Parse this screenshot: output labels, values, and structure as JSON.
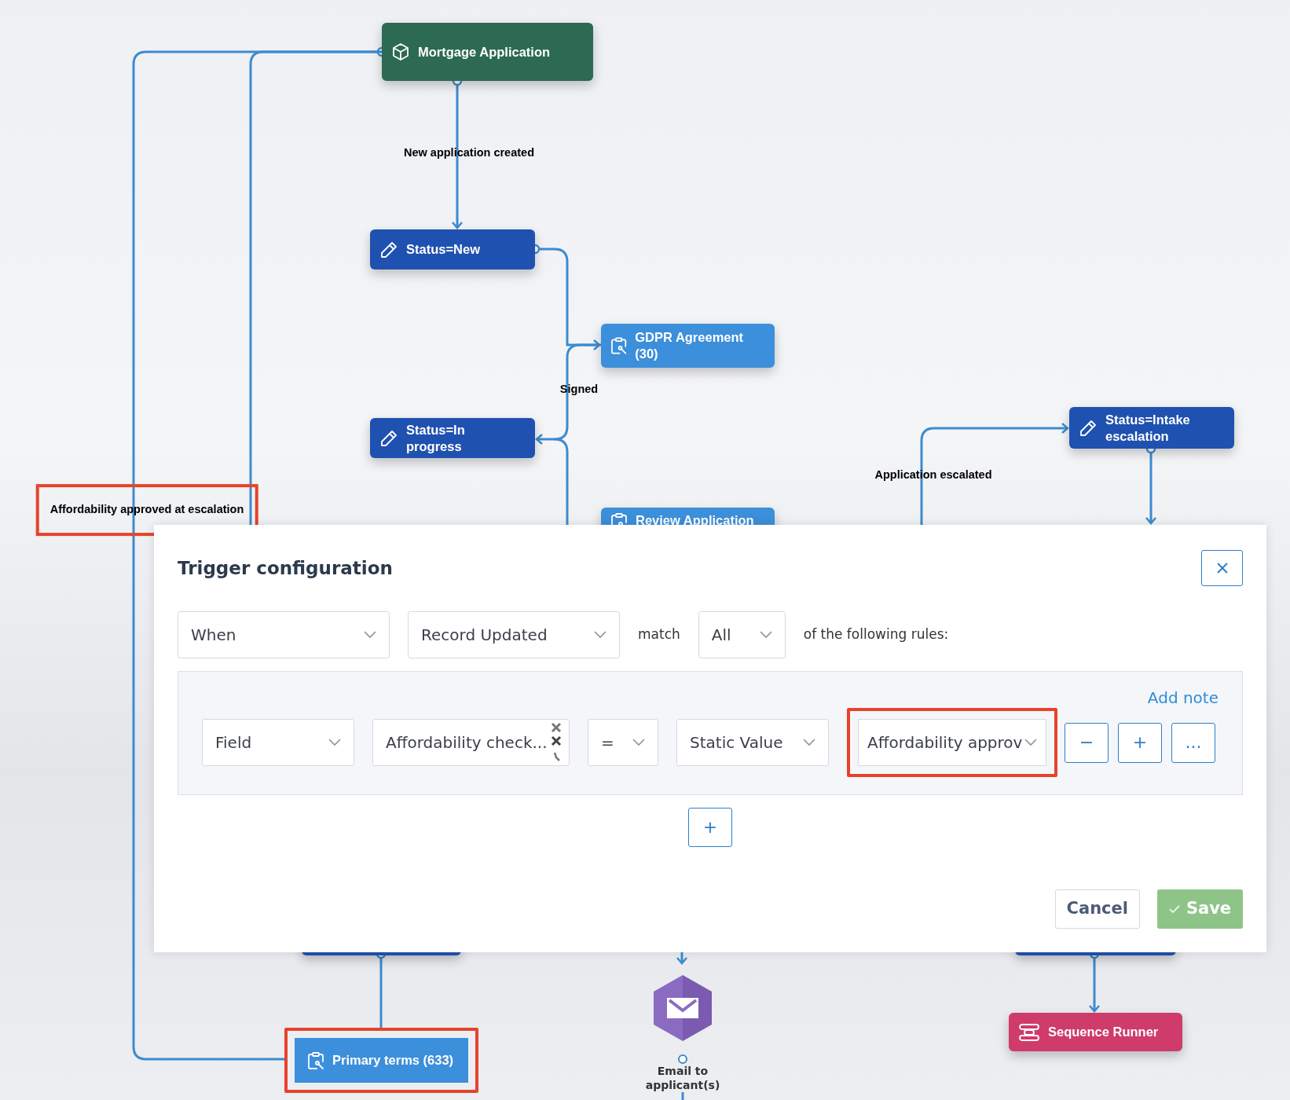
{
  "canvas": {
    "nodes": [
      {
        "kind": "record",
        "label": "Mortgage Application",
        "highlighted": false
      },
      {
        "kind": "status",
        "label": "Status=New",
        "highlighted": false
      },
      {
        "kind": "form",
        "label": "GDPR Agreement (30)",
        "highlighted": false
      },
      {
        "kind": "status",
        "label": "Status=In progress",
        "highlighted": false
      },
      {
        "kind": "form",
        "label": "Review Application",
        "highlighted": false
      },
      {
        "kind": "status",
        "label": "Status=Intake escalation",
        "highlighted": false
      },
      {
        "kind": "form",
        "label": "Primary terms (633)",
        "highlighted": true
      },
      {
        "kind": "email",
        "label": "Email to applicant(s)",
        "highlighted": false
      },
      {
        "kind": "runner",
        "label": "Sequence Runner",
        "highlighted": false
      }
    ],
    "edge_labels": [
      {
        "text": "New application created",
        "highlighted": false
      },
      {
        "text": "Signed",
        "highlighted": false
      },
      {
        "text": "Application escalated",
        "highlighted": false
      },
      {
        "text": "Affordability approved at escalation",
        "highlighted": true
      }
    ]
  },
  "dialog": {
    "title": "Trigger configuration",
    "when": "When",
    "event": "Record Updated",
    "match_label": "match",
    "match": "All",
    "rules_label": "of the following rules:",
    "add_note": "Add note",
    "rules": [
      {
        "source": "Field",
        "field": "Affordability check...",
        "operator": "=",
        "value_type": "Static Value",
        "value": "Affordability approv",
        "highlighted": true,
        "actions": [
          "−",
          "+",
          "..."
        ]
      }
    ],
    "add_rule": "+",
    "cancel": "Cancel",
    "save": "Save",
    "save_disabled": true
  }
}
